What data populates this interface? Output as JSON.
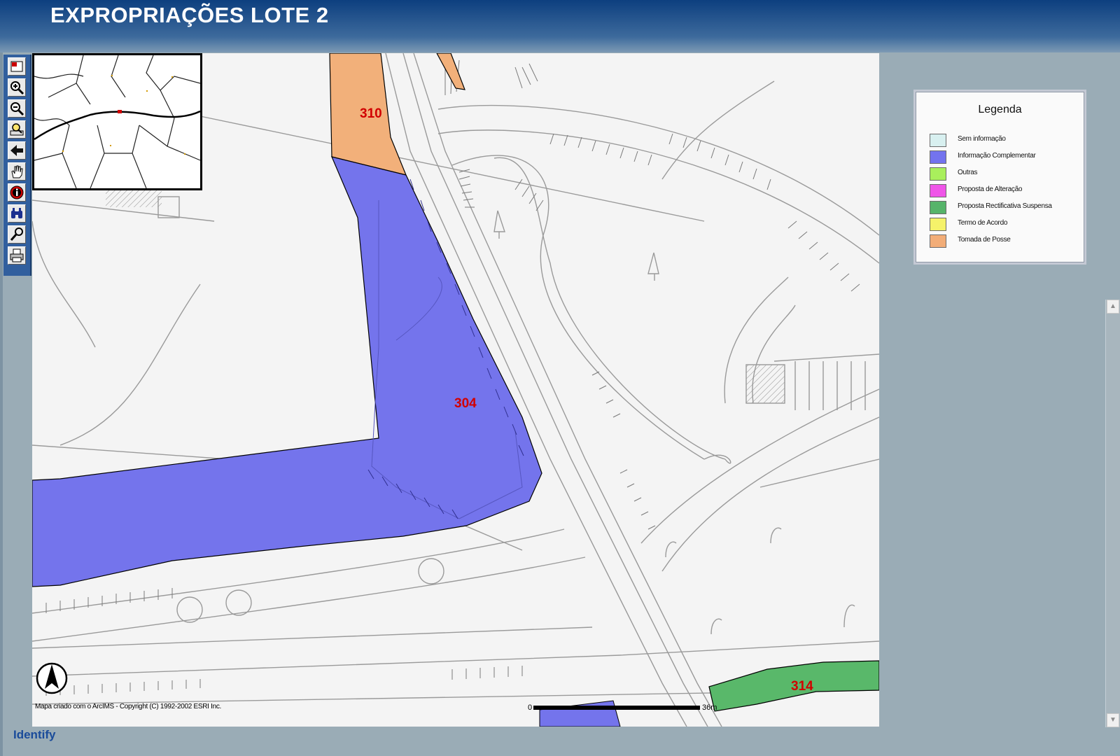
{
  "header": {
    "title": "EXPROPRIAÇÕES LOTE 2"
  },
  "toolbar": {
    "tools": [
      {
        "icon": "toggle-overview-icon"
      },
      {
        "icon": "zoom-in-icon"
      },
      {
        "icon": "zoom-out-icon"
      },
      {
        "icon": "full-extent-icon"
      },
      {
        "icon": "back-icon"
      },
      {
        "icon": "pan-hand-icon"
      },
      {
        "icon": "identify-icon"
      },
      {
        "icon": "find-binoculars-icon"
      },
      {
        "icon": "query-icon"
      },
      {
        "icon": "print-icon"
      }
    ]
  },
  "map": {
    "parcels": [
      {
        "id": "310",
        "status": "Tomada de Posse",
        "color": "#f2b07a"
      },
      {
        "id": "304",
        "status": "Informação Complementar",
        "color": "#7474ec"
      },
      {
        "id": "314",
        "status": "Proposta Rectificativa Suspensa",
        "color": "#59b86a"
      }
    ],
    "label_color": "#d10000",
    "copyright": "Mapa criado com o ArcIMS - Copyright (C) 1992-2002 ESRI Inc.",
    "scalebar": {
      "start": "0",
      "end": "36m"
    }
  },
  "legend": {
    "title": "Legenda",
    "items": [
      {
        "label": "Sem informação",
        "color": "#d8f0f0"
      },
      {
        "label": "Informação Complementar",
        "color": "#7373ee"
      },
      {
        "label": "Outras",
        "color": "#a9ef5c"
      },
      {
        "label": "Proposta de Alteração",
        "color": "#ef55e8"
      },
      {
        "label": "Proposta Rectificativa Suspensa",
        "color": "#56b46a"
      },
      {
        "label": "Termo de Acordo",
        "color": "#f5f26a"
      },
      {
        "label": "Tomada de Posse",
        "color": "#f2ad78"
      }
    ]
  },
  "scrollbar": {
    "up": "▲",
    "down": "▼"
  },
  "status": {
    "mode": "Identify"
  }
}
